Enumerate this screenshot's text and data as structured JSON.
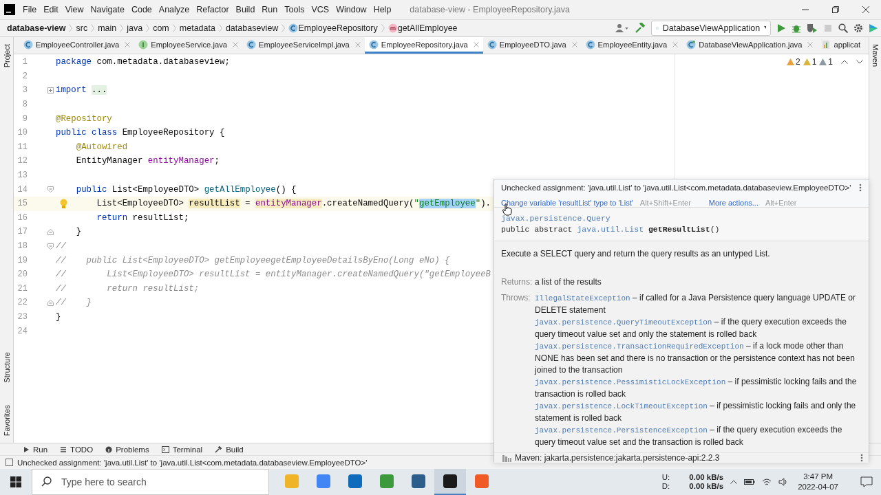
{
  "window": {
    "title": "database-view - EmployeeRepository.java"
  },
  "menu": [
    "File",
    "Edit",
    "View",
    "Navigate",
    "Code",
    "Analyze",
    "Refactor",
    "Build",
    "Run",
    "Tools",
    "VCS",
    "Window",
    "Help"
  ],
  "breadcrumbs": [
    {
      "label": "database-view",
      "kind": "project"
    },
    {
      "label": "src",
      "kind": "folder"
    },
    {
      "label": "main",
      "kind": "folder"
    },
    {
      "label": "java",
      "kind": "folder"
    },
    {
      "label": "com",
      "kind": "folder"
    },
    {
      "label": "metadata",
      "kind": "folder"
    },
    {
      "label": "databaseview",
      "kind": "folder"
    },
    {
      "label": "EmployeeRepository",
      "kind": "class"
    },
    {
      "label": "getAllEmployee",
      "kind": "method"
    }
  ],
  "run_configuration": {
    "label": "DatabaseViewApplication"
  },
  "tabs": [
    {
      "label": "EmployeeController.java",
      "kind": "class",
      "selected": false,
      "closable": true
    },
    {
      "label": "EmployeeService.java",
      "kind": "interface",
      "selected": false,
      "closable": true
    },
    {
      "label": "EmployeeServiceImpl.java",
      "kind": "class",
      "selected": false,
      "closable": true
    },
    {
      "label": "EmployeeRepository.java",
      "kind": "class",
      "selected": true,
      "closable": true
    },
    {
      "label": "EmployeeDTO.java",
      "kind": "class",
      "selected": false,
      "closable": true
    },
    {
      "label": "EmployeeEntity.java",
      "kind": "class",
      "selected": false,
      "closable": true
    },
    {
      "label": "DatabaseViewApplication.java",
      "kind": "app",
      "selected": false,
      "closable": true
    },
    {
      "label": "applicat",
      "kind": "properties",
      "selected": false,
      "closable": false
    }
  ],
  "side_panels": {
    "left_top": [
      "Project"
    ],
    "left_bottom": [
      "Structure",
      "Favorites"
    ],
    "right": [
      "Maven"
    ]
  },
  "inspections": [
    {
      "count": "2",
      "color": "#e8a33d"
    },
    {
      "count": "1",
      "color": "#d9b53c"
    },
    {
      "count": "1",
      "color": "#8e9aa6"
    }
  ],
  "editor": {
    "lines": [
      {
        "number": "1",
        "kind": "plain",
        "current": false,
        "bulb": false,
        "tokens": [
          {
            "text": "package",
            "kind": "keyword"
          },
          {
            "text": " com.metadata.databaseview;",
            "kind": "plain"
          }
        ]
      },
      {
        "number": "2",
        "kind": "plain",
        "current": false,
        "bulb": false
      },
      {
        "number": "3",
        "kind": "fold_collapsed",
        "current": false,
        "bulb": false,
        "tokens": [
          {
            "text": "import ",
            "kind": "keyword"
          },
          {
            "text": "...",
            "kind": "folded"
          }
        ]
      },
      {
        "number": "8",
        "kind": "plain",
        "current": false,
        "bulb": false
      },
      {
        "number": "9",
        "kind": "plain",
        "current": false,
        "bulb": false,
        "tokens": [
          {
            "text": "@Repository",
            "kind": "annotation"
          }
        ]
      },
      {
        "number": "10",
        "kind": "plain",
        "current": false,
        "bulb": false,
        "tokens": [
          {
            "text": "public class",
            "kind": "keyword"
          },
          {
            "text": " EmployeeRepository {",
            "kind": "plain"
          }
        ]
      },
      {
        "number": "11",
        "kind": "plain",
        "current": false,
        "bulb": false,
        "tokens": [
          {
            "text": "    @Autowired",
            "kind": "annotation"
          }
        ]
      },
      {
        "number": "12",
        "kind": "plain",
        "current": false,
        "bulb": false,
        "tokens": [
          {
            "text": "    EntityManager ",
            "kind": "plain"
          },
          {
            "text": "entityManager",
            "kind": "field"
          },
          {
            "text": ";",
            "kind": "plain"
          }
        ]
      },
      {
        "number": "13",
        "kind": "plain",
        "current": false,
        "bulb": false
      },
      {
        "number": "14",
        "kind": "fold_start",
        "current": false,
        "bulb": false,
        "tokens": [
          {
            "text": "    public",
            "kind": "keyword"
          },
          {
            "text": " List<EmployeeDTO> ",
            "kind": "plain"
          },
          {
            "text": "getAllEmployee",
            "kind": "method"
          },
          {
            "text": "() {",
            "kind": "plain"
          }
        ]
      },
      {
        "number": "15",
        "kind": "plain",
        "current": true,
        "bulb": true,
        "tokens": [
          {
            "text": "        List<EmployeeDTO> ",
            "kind": "plain"
          },
          {
            "text": "resultList",
            "kind": "highlight"
          },
          {
            "text": " = ",
            "kind": "plain"
          },
          {
            "text": "entityManager",
            "kind": "field_highlight"
          },
          {
            "text": ".createNamedQuery(",
            "kind": "plain"
          },
          {
            "text": "\"",
            "kind": "string"
          },
          {
            "text": "getEmployee",
            "kind": "selection"
          },
          {
            "text": "\"",
            "kind": "string"
          },
          {
            "text": ").",
            "kind": "plain"
          }
        ]
      },
      {
        "number": "16",
        "kind": "plain",
        "current": false,
        "bulb": false,
        "tokens": [
          {
            "text": "        return",
            "kind": "keyword"
          },
          {
            "text": " resultList;",
            "kind": "plain"
          }
        ]
      },
      {
        "number": "17",
        "kind": "fold_end",
        "current": false,
        "bulb": false,
        "tokens": [
          {
            "text": "    }",
            "kind": "plain"
          }
        ]
      },
      {
        "number": "18",
        "kind": "fold_start",
        "current": false,
        "bulb": false,
        "tokens": [
          {
            "text": "//",
            "kind": "comment"
          }
        ]
      },
      {
        "number": "19",
        "kind": "plain",
        "current": false,
        "bulb": false,
        "tokens": [
          {
            "text": "//    public List<EmployeeDTO> getEmployeegetEmployeeDetailsByEno(Long eNo) {",
            "kind": "comment"
          }
        ]
      },
      {
        "number": "20",
        "kind": "plain",
        "current": false,
        "bulb": false,
        "tokens": [
          {
            "text": "//        List<EmployeeDTO> resultList = entityManager.createNamedQuery(\"getEmployeeB",
            "kind": "comment"
          }
        ]
      },
      {
        "number": "21",
        "kind": "plain",
        "current": false,
        "bulb": false,
        "tokens": [
          {
            "text": "//        return resultList;",
            "kind": "comment"
          }
        ]
      },
      {
        "number": "22",
        "kind": "fold_end",
        "current": false,
        "bulb": false,
        "tokens": [
          {
            "text": "//    }",
            "kind": "comment"
          }
        ]
      },
      {
        "number": "23",
        "kind": "plain",
        "current": false,
        "bulb": false,
        "tokens": [
          {
            "text": "}",
            "kind": "plain"
          }
        ]
      },
      {
        "number": "24",
        "kind": "plain",
        "current": false,
        "bulb": false
      }
    ]
  },
  "popup": {
    "problem": "Unchecked assignment: 'java.util.List' to 'java.util.List<com.metadata.databaseview.EmployeeDTO>'",
    "fixes": [
      {
        "label": "Change variable 'resultList' type to 'List'",
        "shortcut": "Alt+Shift+Enter"
      },
      {
        "label": "More actions...",
        "shortcut": "Alt+Enter"
      }
    ],
    "doc": {
      "container": "javax.persistence.Query",
      "signature": [
        {
          "text": "public abstract ",
          "kind": "plain"
        },
        {
          "text": "java.util.List",
          "kind": "link"
        },
        {
          "text": " getResultList",
          "kind": "name"
        },
        {
          "text": "()",
          "kind": "plain"
        }
      ],
      "description": "Execute a SELECT query and return the query results as an untyped List.",
      "returns_label": "Returns:",
      "returns": "a list of the results",
      "throws_label": "Throws:",
      "throws": [
        {
          "exception": "IllegalStateException",
          "description": "– if called for a Java Persistence query language UPDATE or DELETE statement"
        },
        {
          "exception": "javax.persistence.QueryTimeoutException",
          "description": "– if the query execution exceeds the query timeout value set and only the statement is rolled back"
        },
        {
          "exception": "javax.persistence.TransactionRequiredException",
          "description": "– if a lock mode other than NONE has been set and there is no transaction or the persistence context has not been joined to the transaction"
        },
        {
          "exception": "javax.persistence.PessimisticLockException",
          "description": "– if pessimistic locking fails and the transaction is rolled back"
        },
        {
          "exception": "javax.persistence.LockTimeoutException",
          "description": "– if pessimistic locking fails and only the statement is rolled back"
        },
        {
          "exception": "javax.persistence.PersistenceException",
          "description": "– if the query execution exceeds the query timeout value set and the transaction is rolled back"
        }
      ]
    },
    "source": "Maven: jakarta.persistence:jakarta.persistence-api:2.2.3"
  },
  "tool_windows": [
    {
      "label": "Run",
      "kind": "run"
    },
    {
      "label": "TODO",
      "kind": "todo"
    },
    {
      "label": "Problems",
      "kind": "problems"
    },
    {
      "label": "Terminal",
      "kind": "terminal"
    },
    {
      "label": "Build",
      "kind": "build"
    }
  ],
  "status_bar": {
    "message": "Unchecked assignment: 'java.util.List' to 'java.util.List<com.metadata.databaseview.EmployeeDTO>'"
  },
  "taskbar": {
    "search": {
      "placeholder": "Type here to search"
    },
    "apps": [
      {
        "color": "#f0b429",
        "selected": false
      },
      {
        "color": "#4285f4",
        "selected": false
      },
      {
        "color": "#0f6cbd",
        "selected": false
      },
      {
        "color": "#3c9a3c",
        "selected": false
      },
      {
        "color": "#2d5d8a",
        "selected": false
      },
      {
        "color": "#1a1a1a",
        "selected": true
      },
      {
        "color": "#f05a24",
        "selected": false
      }
    ],
    "network": [
      {
        "label": "U:",
        "value": "0.00 kB/s"
      },
      {
        "label": "D:",
        "value": "0.00 kB/s"
      }
    ],
    "time": "3:47 PM",
    "date": "2022-04-07"
  }
}
